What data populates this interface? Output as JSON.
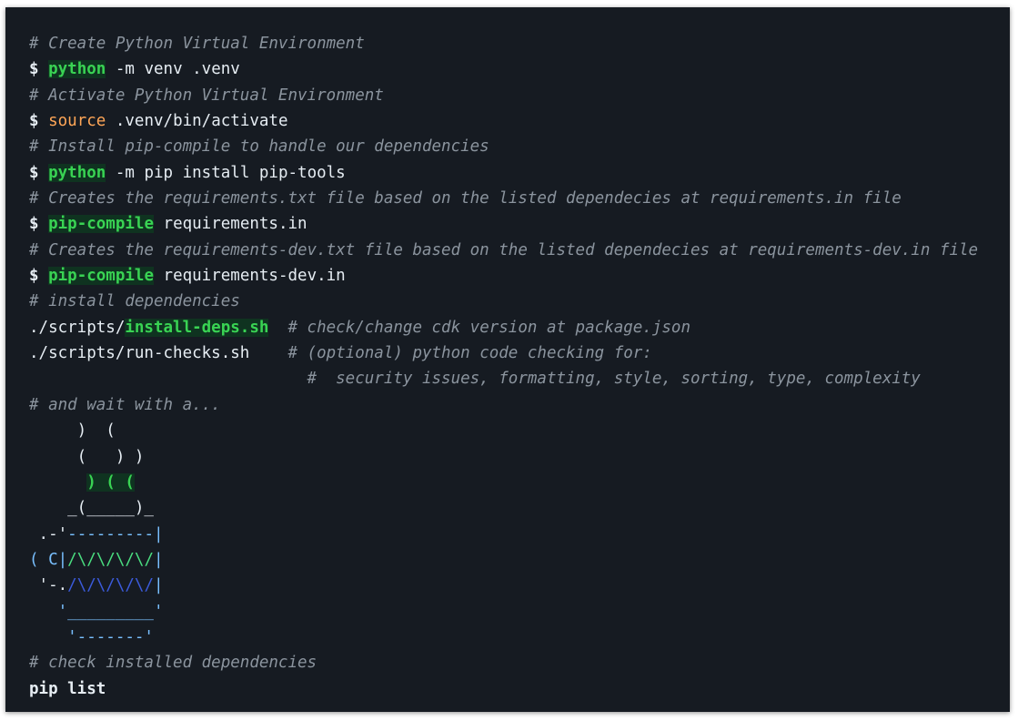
{
  "lines": {
    "l1": "# Create Python Virtual Environment",
    "l2_cmd": "python",
    "l2_args": " -m venv .venv",
    "l3": "# Activate Python Virtual Environment",
    "l4_cmd": "source",
    "l4_args": " .venv/bin/activate",
    "l5": "# Install pip-compile to handle our dependencies",
    "l6_cmd": "python",
    "l6_args": " -m pip install pip-tools",
    "l7": "# Creates the requirements.txt file based on the listed dependecies at requirements.in file",
    "l8_cmd": "pip-compile",
    "l8_args": " requirements.in",
    "l9": "# Creates the requirements-dev.txt file based on the listed dependecies at requirements-dev.in file",
    "l10_cmd": "pip-compile",
    "l10_args": " requirements-dev.in",
    "l11": "# install dependencies",
    "l12_prefix": "./scripts/",
    "l12_script": "install-deps.sh",
    "l12_comment": "  # check/change cdk version at package.json",
    "l13_cmd": "./scripts/run-checks.sh",
    "l13_comment": "    # (optional) python code checking for:",
    "l14_comment": "                             #  security issues, formatting, style, sorting, type, complexity",
    "l15": "# and wait with a...",
    "l26": "# check installed dependencies",
    "l27": "pip list"
  },
  "prompt": "$",
  "ascii_art": {
    "a1": "     )  (",
    "a2": "     (   ) )",
    "a3_indent": "      ",
    "a3_steam": ") ( (",
    "a4": "    _(_____)_",
    "a5_left": " .-'",
    "a5_right": "---------|",
    "a6_left": "( C|",
    "a6_right": "/\\/\\/\\/\\/",
    "a6_end": "|",
    "a7_left": " '-.",
    "a7_right": "/\\/\\/\\/\\/",
    "a7_end": "|",
    "a8": "   '_________'",
    "a9": "    '-------'"
  },
  "colors": {
    "background": "#161b22",
    "comment": "#8b949e",
    "command_highlight": "#39d353",
    "source_keyword": "#ffa657",
    "cup_outline": "#79c0ff",
    "cup_pattern_green": "#4ade80",
    "cup_pattern_blue": "#3b5bdb"
  }
}
